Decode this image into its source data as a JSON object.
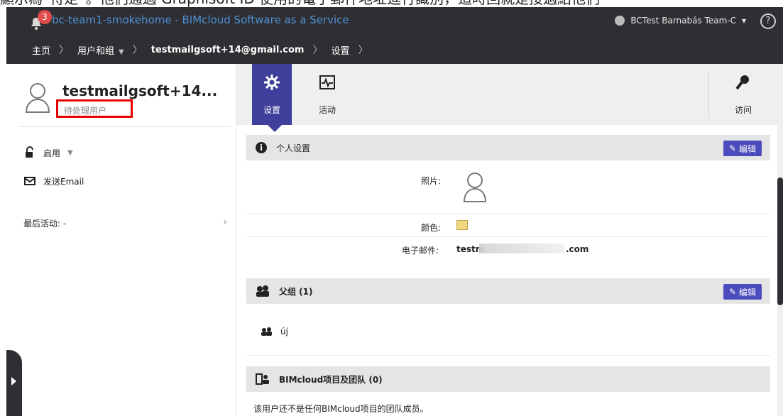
{
  "caption_text": "顯示為“待定”。他們通過 Graphisoft ID 使用的電子郵件地址進行識別，這時回就是接過給他們",
  "header": {
    "badge_count": "3",
    "app_title": "bc-team1-smokehome - BIMcloud Software as a Service",
    "user_name": "BCTest Barnabás Team-C",
    "user_caret": "▾",
    "help_label": "?",
    "breadcrumbs": [
      {
        "label": "主页"
      },
      {
        "label": "用户和组"
      },
      {
        "label": "testmailgsoft+14@gmail.com"
      },
      {
        "label": "设置"
      }
    ]
  },
  "left": {
    "username": "testmailgsoft+14...",
    "pending_label": "待处理用户",
    "enabled_label": "启用",
    "send_email_label": "发送Email",
    "last_activity_label": "最后活动: -"
  },
  "right": {
    "tabs": [
      {
        "label": "设置"
      },
      {
        "label": "活动"
      },
      {
        "label": "访问"
      }
    ],
    "personal_settings": {
      "title": "个人设置",
      "edit_label": "编辑",
      "photo_label": "照片:",
      "color_label": "颜色:",
      "email_label": "电子邮件:",
      "email_prefix": "testm",
      "email_suffix": ".com"
    },
    "parent_groups": {
      "title": "父组 (1)",
      "edit_label": "编辑",
      "group_name": "új"
    },
    "projects_teams": {
      "title": "BIMcloud项目及团队 (0)",
      "empty_text": "该用户还不是任何BIMcloud项目的团队成员。"
    }
  },
  "colors": {
    "header_bg": "#2f2f33",
    "accent": "#4b4bbd",
    "tab_active": "#3f3f9c",
    "pending_border": "#e60000",
    "user_color": "#f2d67a"
  }
}
